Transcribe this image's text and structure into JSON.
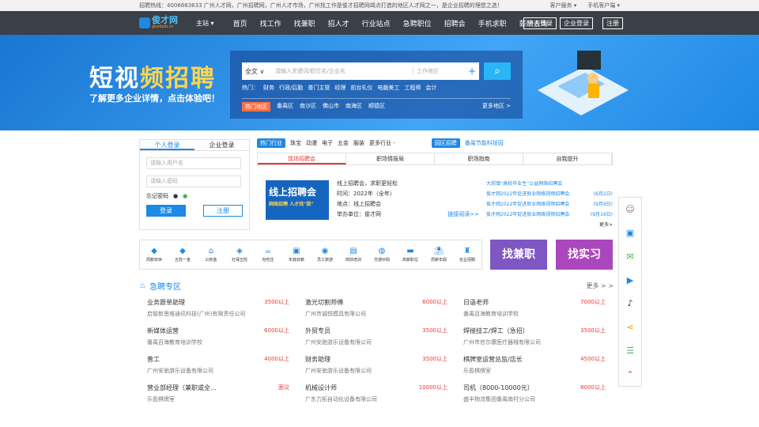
{
  "topbar": {
    "text": "招聘热线：4006683633 广州人才网，广州招聘网，广州人才市场，广州找工作是俊才招聘网竭点打造的地区人才网之一，是企业招聘的理想之选！",
    "service": "客户服务 ▾",
    "mobile": "手机客户端 ▾"
  },
  "nav": {
    "logo": "俊才网",
    "logo_sub": "goodjob.cn",
    "city": "主站 ▾",
    "items": [
      "首页",
      "找工作",
      "找兼职",
      "招人才",
      "行业站点",
      "急聘职位",
      "招聘会",
      "手机求职",
      "薪酬查询"
    ],
    "personal_login": "个人登录",
    "company_login": "企业登录",
    "register": "注册"
  },
  "banner": {
    "title_a": "短视",
    "title_b": "频招聘",
    "subtitle": "了解更多企业详情，点击体验吧！"
  },
  "search": {
    "category": "全文 ∨",
    "keyword_placeholder": "请输入关键词/职位名/企业名",
    "location_placeholder": "工作地区",
    "hot_label": "热门：",
    "hot": [
      "财务",
      "行政/后勤",
      "普门主管",
      "经理",
      "前台礼仪",
      "电脑美工",
      "工程师",
      "会计"
    ],
    "area_label": "热门地区",
    "areas": [
      "番禺区",
      "南沙区",
      "佛山市",
      "南海区",
      "顺德区"
    ],
    "more_areas": "更多地区 >"
  },
  "login": {
    "tab_personal": "个人登录",
    "tab_company": "企业登录",
    "user_placeholder": "请输入用户名",
    "pwd_placeholder": "请输入密码",
    "forgot": "忘记密码",
    "login_btn": "登录",
    "register_btn": "注册"
  },
  "industry": {
    "label": "热门行业",
    "items": [
      "珠宝",
      "动漫",
      "电子",
      "五金",
      "服装"
    ],
    "more": "更多行业 -",
    "park_label": "园区招聘",
    "park": "番禺节能科技园"
  },
  "tabs": [
    "现场招聘会",
    "职场情报局",
    "职场指南",
    "自我提升"
  ],
  "fair": {
    "img_title": "线上招聘会",
    "img_sub": "网络招聘 人才找\"我\"",
    "name": "线上招聘会，求职更轻松",
    "time": "时间：2022年（全年）",
    "place": "地点：线上招聘会",
    "org": "举办单位：俊才网",
    "detail": "链接阅读>>",
    "list": [
      {
        "t": "大岗镇“高校毕业生”公益网络招聘会",
        "d": ""
      },
      {
        "t": "俊才网2022年促进就业网络视频招聘会",
        "d": "(6月2日)"
      },
      {
        "t": "俊才网2022年促进就业网络视频招聘会",
        "d": "(9月9日)"
      },
      {
        "t": "俊才网2022年促进就业网络视频招聘会",
        "d": "(9月16日)"
      }
    ],
    "more": "更多>"
  },
  "benefits": [
    "周薪双休",
    "五险一金",
    "公积金",
    "社保五险",
    "包吃住",
    "年底双薪",
    "员工旅游",
    "岗前培训",
    "交通补助",
    "高薪职位",
    "周薪年假",
    "名企招聘"
  ],
  "promos": {
    "part_time": "找兼职",
    "intern": "找实习"
  },
  "urgent": {
    "title": "急聘专区",
    "more": "更多 > >",
    "jobs": [
      {
        "title": "业务跟单助理",
        "salary": "3500以上",
        "company": "启智新思维通讯科技(广州)有限责任公司"
      },
      {
        "title": "激光切割师傅",
        "salary": "6000以上",
        "company": "广州市诚悦模具有限公司"
      },
      {
        "title": "日语老师",
        "salary": "7000以上",
        "company": "番禺百海教育培训学校"
      },
      {
        "title": "新媒体运营",
        "salary": "6000以上",
        "company": "番禺百海教育培训学校"
      },
      {
        "title": "外贸专员",
        "salary": "3500以上",
        "company": "广州安驰游乐设备有限公司"
      },
      {
        "title": "焊接技工/焊工（急招）",
        "salary": "3500以上",
        "company": "广州市信尔康医疗器械有限公司"
      },
      {
        "title": "普工",
        "salary": "4000以上",
        "company": "广州安驰游乐设备有限公司"
      },
      {
        "title": "财务助理",
        "salary": "3500以上",
        "company": "广州安驰游乐设备有限公司"
      },
      {
        "title": "棋牌室运营总监/店长",
        "salary": "4500以上",
        "company": "乐盈棋牌室"
      },
      {
        "title": "营业部经理（兼职或全...",
        "salary": "面议",
        "company": "乐盈棋牌室"
      },
      {
        "title": "机械设计师",
        "salary": "10000以上",
        "company": "广东力拓自动化设备有限公司"
      },
      {
        "title": "司机（8000-10000元）",
        "salary": "8000以上",
        "company": "盛丰物流集团番禺南村分公司"
      }
    ]
  }
}
